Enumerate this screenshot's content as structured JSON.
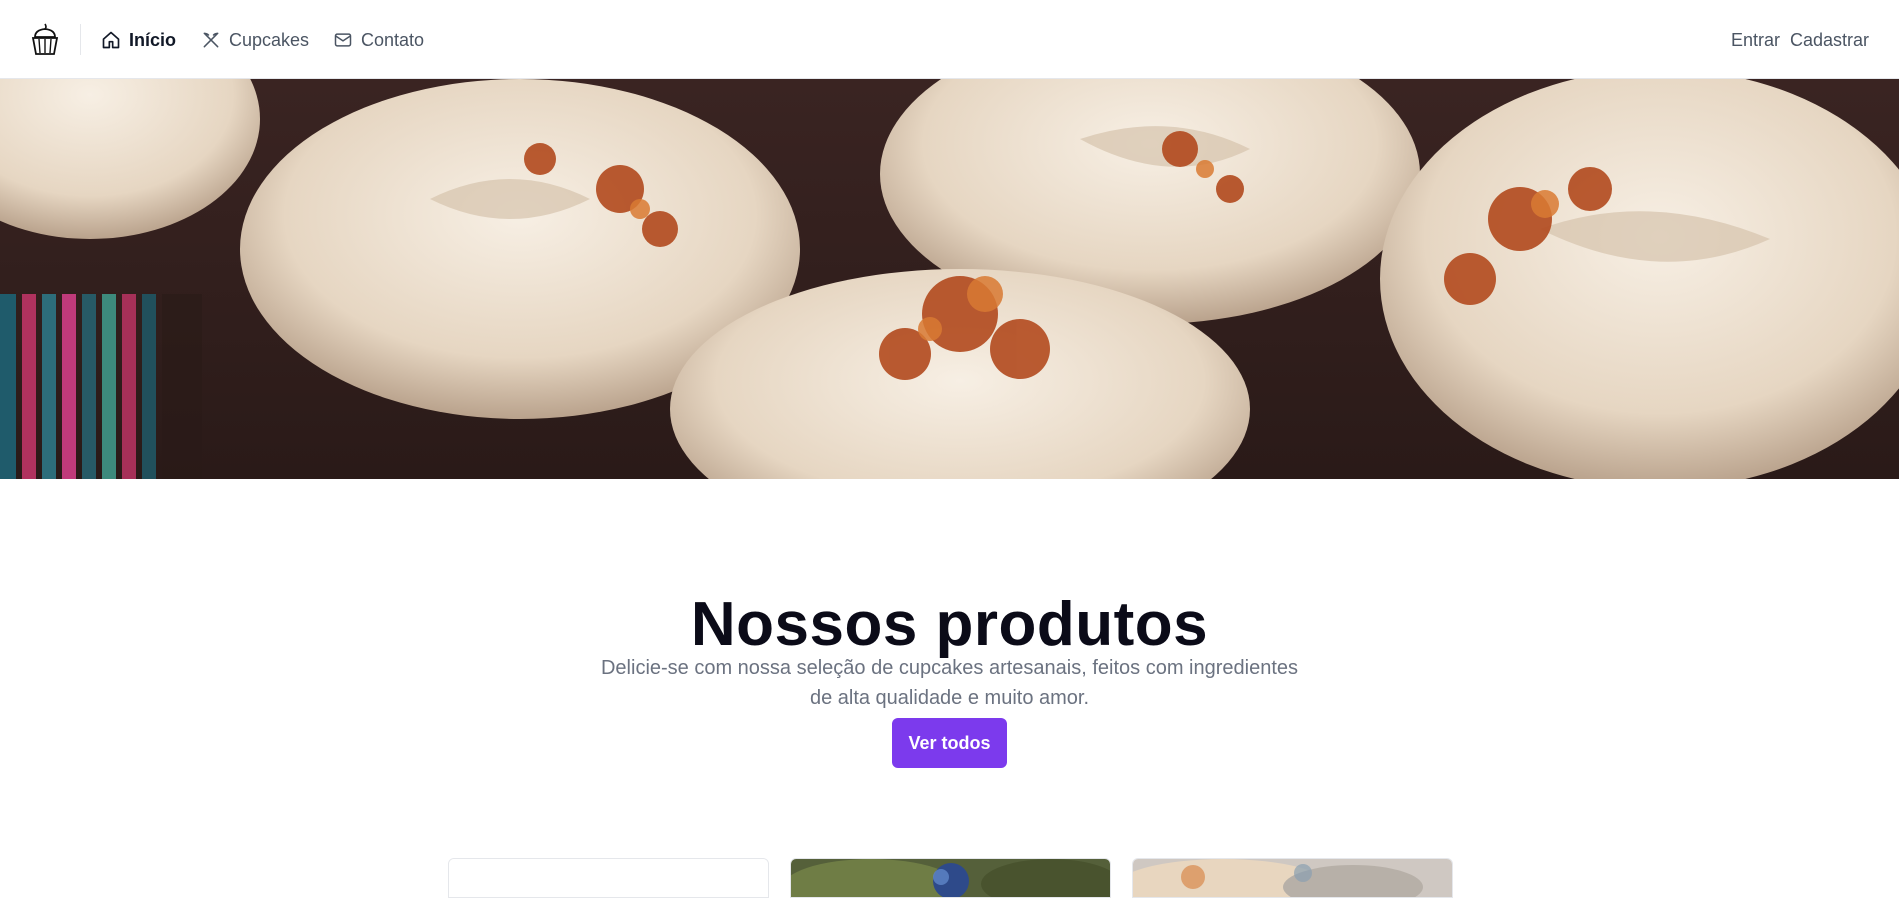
{
  "nav": {
    "logo_icon": "cupcake-icon",
    "items": [
      {
        "label": "Início",
        "icon": "home-icon",
        "active": true
      },
      {
        "label": "Cupcakes",
        "icon": "utensils-icon",
        "active": false
      },
      {
        "label": "Contato",
        "icon": "mail-icon",
        "active": false
      }
    ],
    "login_label": "Entrar",
    "signup_label": "Cadastrar"
  },
  "hero": {
    "image": "cupcakes-frosting-banner"
  },
  "products": {
    "title": "Nossos produtos",
    "subtitle": "Delicie-se com nossa seleção de cupcakes artesanais, feitos com ingredientes de alta qualidade e muito amor.",
    "cta_label": "Ver todos",
    "cards": [
      {
        "image": "blank-card-image"
      },
      {
        "image": "blueberry-cupcake-image"
      },
      {
        "image": "frosted-cupcake-image"
      }
    ]
  },
  "colors": {
    "accent": "#7c3aed",
    "text_primary": "#0b0b18",
    "text_muted": "#6b7280",
    "border": "#e5e7eb"
  }
}
